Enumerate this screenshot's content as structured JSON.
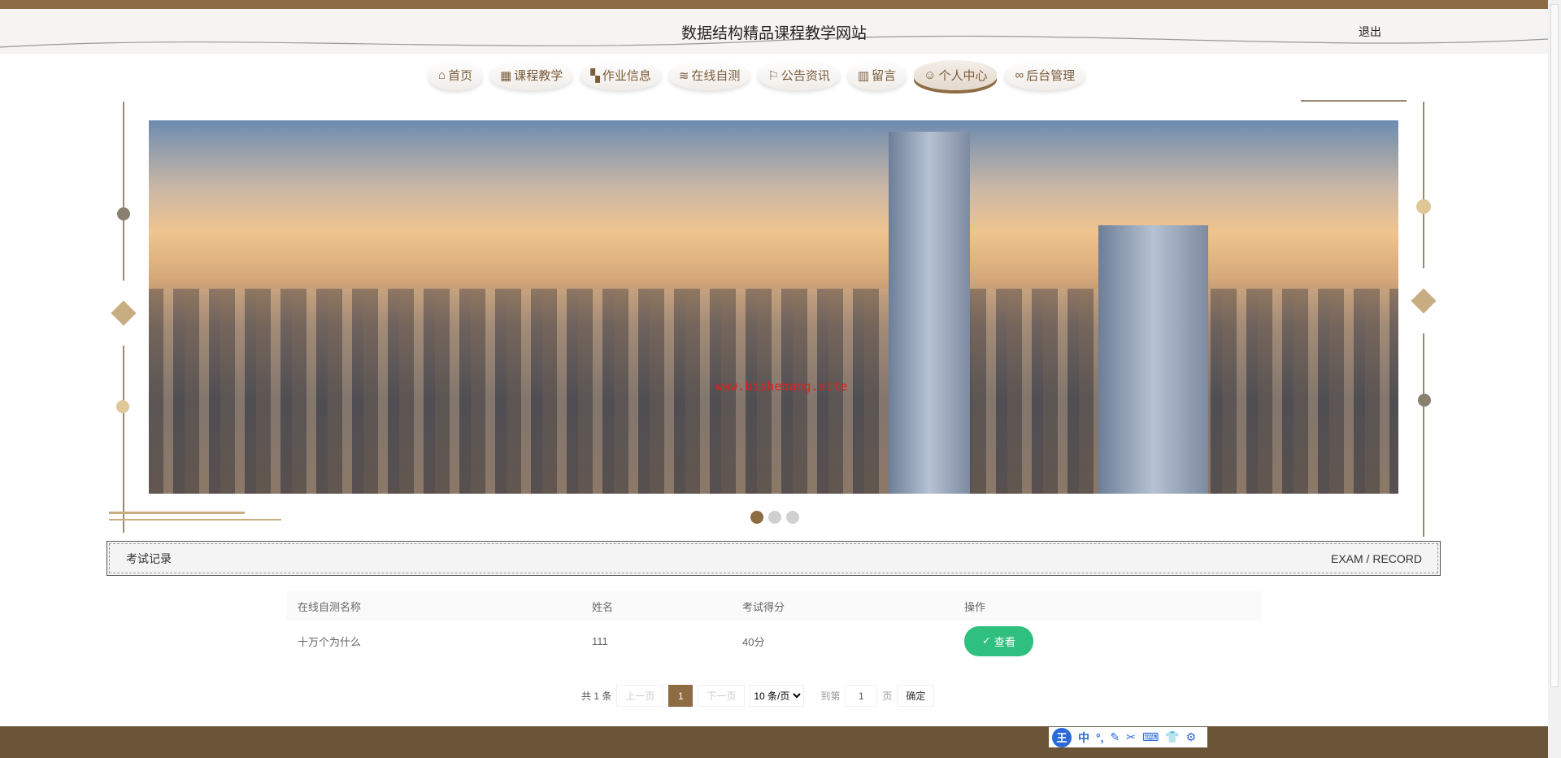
{
  "header": {
    "title": "数据结构精品课程教学网站",
    "logout": "退出"
  },
  "nav": [
    {
      "label": "首页",
      "icon": "home-icon",
      "glyph": "⌂"
    },
    {
      "label": "课程教学",
      "icon": "book-icon",
      "glyph": "▦"
    },
    {
      "label": "作业信息",
      "icon": "grid-icon",
      "glyph": "▚"
    },
    {
      "label": "在线自测",
      "icon": "layers-icon",
      "glyph": "≋"
    },
    {
      "label": "公告资讯",
      "icon": "flag-icon",
      "glyph": "⚐"
    },
    {
      "label": "留言",
      "icon": "message-icon",
      "glyph": "▥"
    },
    {
      "label": "个人中心",
      "icon": "user-icon",
      "glyph": "☺",
      "active": true
    },
    {
      "label": "后台管理",
      "icon": "link-icon",
      "glyph": "∞"
    }
  ],
  "banner": {
    "watermark": "www.bishebang.site",
    "slides": 3,
    "current": 1
  },
  "section": {
    "title": "考试记录",
    "subtitle": "EXAM / RECORD"
  },
  "table": {
    "headers": [
      "在线自测名称",
      "姓名",
      "考试得分",
      "操作"
    ],
    "rows": [
      {
        "name": "十万个为什么",
        "user": "111",
        "score": "40分",
        "action": "查看"
      }
    ]
  },
  "pager": {
    "total": "共 1 条",
    "prev": "上一页",
    "page": "1",
    "next": "下一页",
    "size": "10 条/页",
    "goto": "到第",
    "goto_value": "1",
    "page_unit": "页",
    "confirm": "确定"
  },
  "colors": {
    "brand": "#8d6b43",
    "footer": "#6b5538",
    "view_button": "#2fbf7f"
  },
  "ime": {
    "logo": "王",
    "items": [
      "中",
      "°,",
      "✎",
      "✂",
      "⌨",
      "👕",
      "⚙"
    ]
  }
}
